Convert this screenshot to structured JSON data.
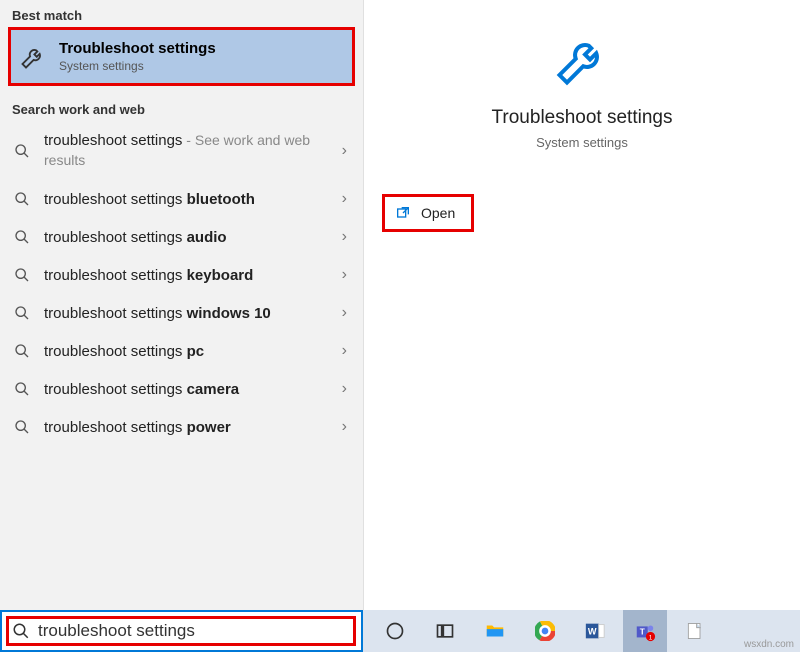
{
  "sections": {
    "best_match_header": "Best match",
    "search_web_header": "Search work and web"
  },
  "best_match": {
    "title": "Troubleshoot settings",
    "subtitle": "System settings"
  },
  "suggestions": [
    {
      "prefix": "troubleshoot settings",
      "bold": "",
      "hint": " - See work and web results"
    },
    {
      "prefix": "troubleshoot settings ",
      "bold": "bluetooth",
      "hint": ""
    },
    {
      "prefix": "troubleshoot settings ",
      "bold": "audio",
      "hint": ""
    },
    {
      "prefix": "troubleshoot settings ",
      "bold": "keyboard",
      "hint": ""
    },
    {
      "prefix": "troubleshoot settings ",
      "bold": "windows 10",
      "hint": ""
    },
    {
      "prefix": "troubleshoot settings ",
      "bold": "pc",
      "hint": ""
    },
    {
      "prefix": "troubleshoot settings ",
      "bold": "camera",
      "hint": ""
    },
    {
      "prefix": "troubleshoot settings ",
      "bold": "power",
      "hint": ""
    }
  ],
  "detail": {
    "title": "Troubleshoot settings",
    "subtitle": "System settings",
    "open_label": "Open"
  },
  "search": {
    "value": "troubleshoot settings"
  },
  "taskbar": {
    "items": [
      "cortana",
      "task-view",
      "file-explorer",
      "chrome",
      "word",
      "teams",
      "notes"
    ]
  },
  "watermark": "wsxdn.com"
}
